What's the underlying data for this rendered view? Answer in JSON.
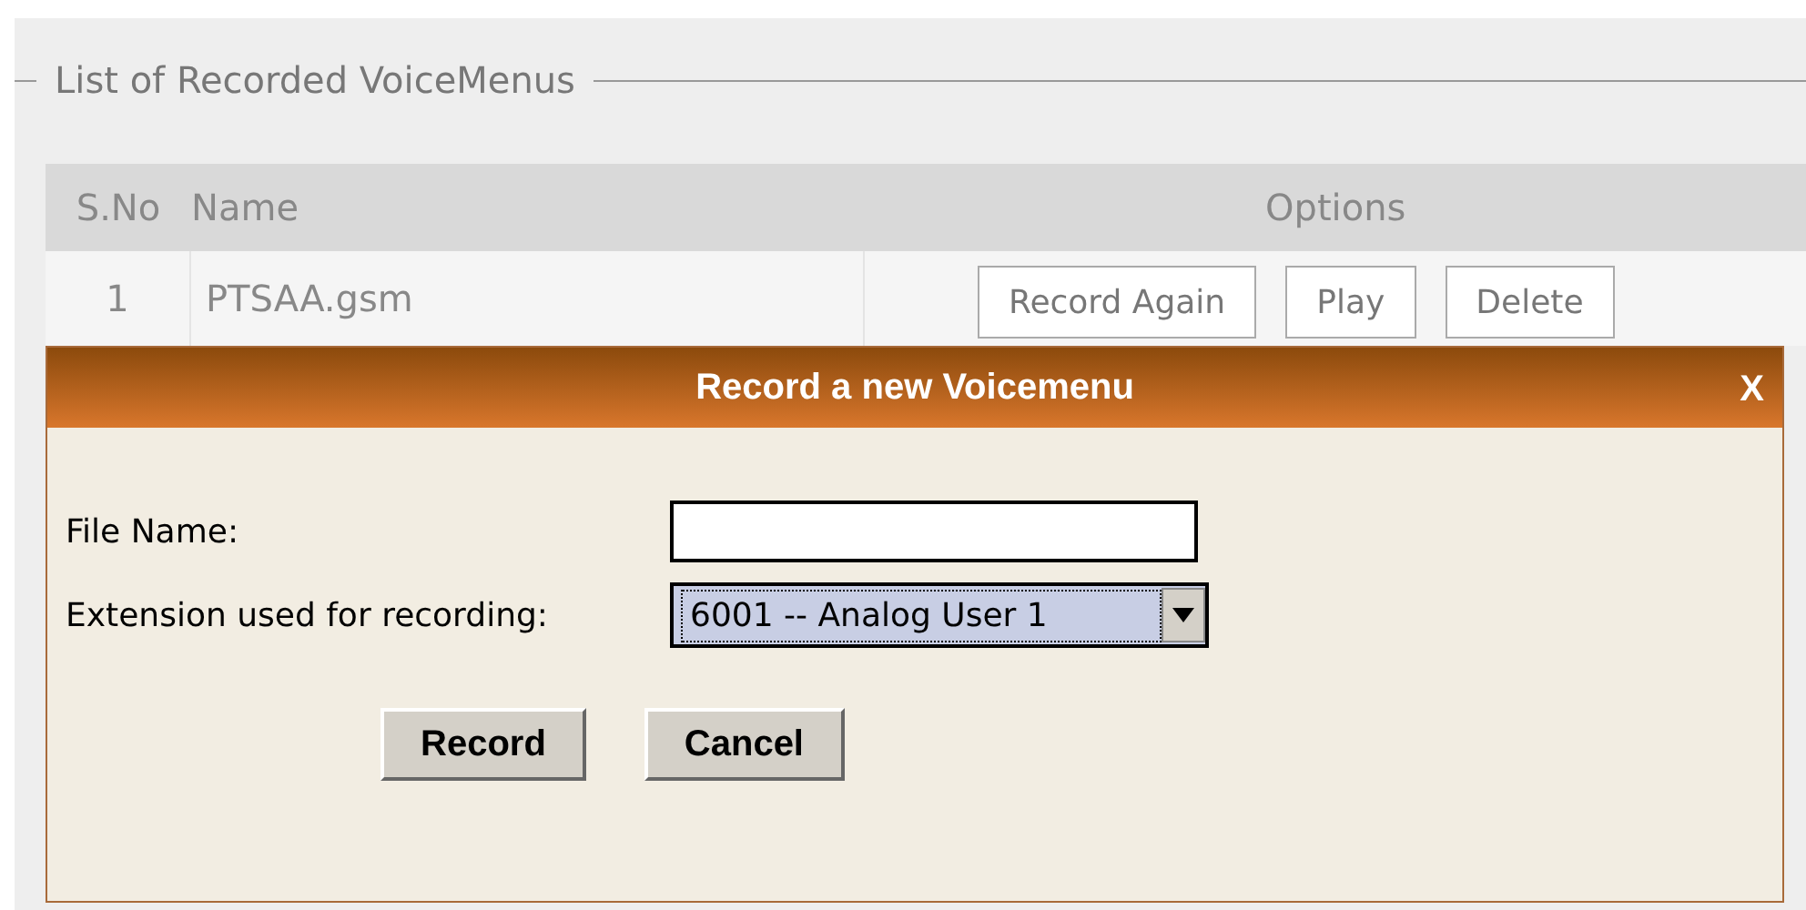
{
  "section": {
    "legend": "List of Recorded VoiceMenus"
  },
  "table": {
    "columns": [
      "S.No",
      "Name",
      "Options"
    ],
    "rows": [
      {
        "sno": "1",
        "name": "PTSAA.gsm",
        "actions": [
          "Record Again",
          "Play",
          "Delete"
        ]
      }
    ]
  },
  "dialog": {
    "title": "Record a new Voicemenu",
    "close": "X",
    "fields": [
      {
        "kind": "text",
        "label": "File Name:"
      },
      {
        "kind": "select",
        "label": "Extension used for recording:",
        "value": "6001 -- Analog User 1"
      }
    ],
    "buttons": [
      "Record",
      "Cancel"
    ]
  }
}
